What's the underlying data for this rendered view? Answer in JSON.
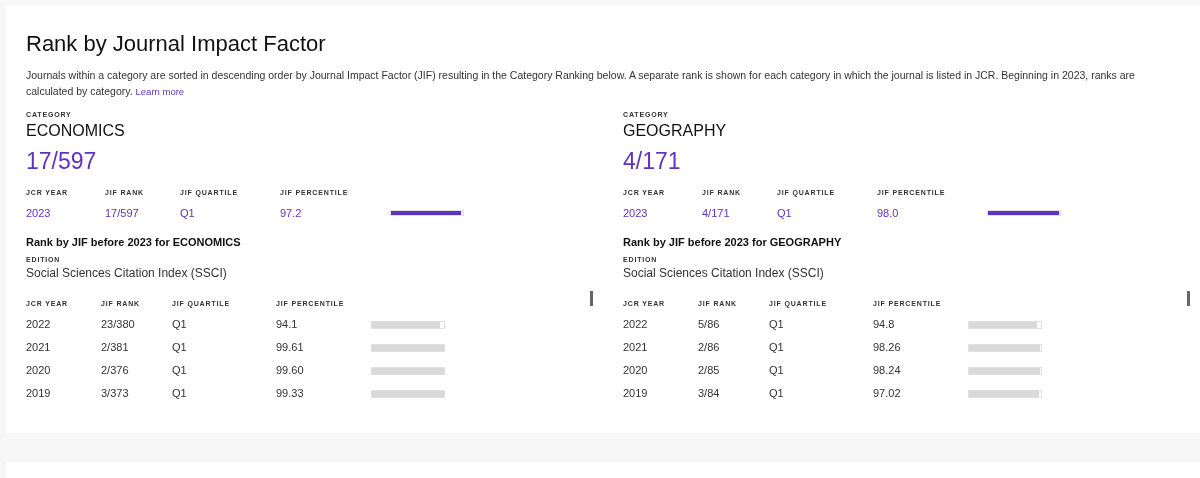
{
  "title": "Rank by Journal Impact Factor",
  "description": "Journals within a category are sorted in descending order by Journal Impact Factor (JIF) resulting in the Category Ranking below. A separate rank is shown for each category in which the journal is listed in JCR. Beginning in 2023, ranks are calculated by category.",
  "learn_more": "Learn more",
  "categories": [
    {
      "category_label": "CATEGORY",
      "name": "ECONOMICS",
      "rank": "17/597",
      "current": {
        "columns": [
          "JCR YEAR",
          "JIF RANK",
          "JIF QUARTILE",
          "JIF PERCENTILE"
        ],
        "row": {
          "year": "2023",
          "rank": "17/597",
          "quartile": "Q1",
          "percentile": "97.2",
          "level": 0.972
        }
      },
      "history_title": "Rank by JIF before 2023 for ECONOMICS",
      "edition_label": "EDITION",
      "edition": "Social Sciences Citation Index (SSCI)",
      "history": {
        "columns": [
          "JCR YEAR",
          "JIF RANK",
          "JIF QUARTILE",
          "JIF PERCENTILE"
        ],
        "rows": [
          {
            "year": "2022",
            "rank": "23/380",
            "quartile": "Q1",
            "percentile": "94.1",
            "level": 0.941
          },
          {
            "year": "2021",
            "rank": "2/381",
            "quartile": "Q1",
            "percentile": "99.61",
            "level": 0.9961
          },
          {
            "year": "2020",
            "rank": "2/376",
            "quartile": "Q1",
            "percentile": "99.60",
            "level": 0.996
          },
          {
            "year": "2019",
            "rank": "3/373",
            "quartile": "Q1",
            "percentile": "99.33",
            "level": 0.9933
          }
        ]
      }
    },
    {
      "category_label": "CATEGORY",
      "name": "GEOGRAPHY",
      "rank": "4/171",
      "current": {
        "columns": [
          "JCR YEAR",
          "JIF RANK",
          "JIF QUARTILE",
          "JIF PERCENTILE"
        ],
        "row": {
          "year": "2023",
          "rank": "4/171",
          "quartile": "Q1",
          "percentile": "98.0",
          "level": 0.98
        }
      },
      "history_title": "Rank by JIF before 2023 for GEOGRAPHY",
      "edition_label": "EDITION",
      "edition": "Social Sciences Citation Index (SSCI)",
      "history": {
        "columns": [
          "JCR YEAR",
          "JIF RANK",
          "JIF QUARTILE",
          "JIF PERCENTILE"
        ],
        "rows": [
          {
            "year": "2022",
            "rank": "5/86",
            "quartile": "Q1",
            "percentile": "94.8",
            "level": 0.948
          },
          {
            "year": "2021",
            "rank": "2/86",
            "quartile": "Q1",
            "percentile": "98.26",
            "level": 0.9826
          },
          {
            "year": "2020",
            "rank": "2/85",
            "quartile": "Q1",
            "percentile": "98.24",
            "level": 0.9824
          },
          {
            "year": "2019",
            "rank": "3/84",
            "quartile": "Q1",
            "percentile": "97.02",
            "level": 0.9702
          }
        ]
      }
    }
  ]
}
